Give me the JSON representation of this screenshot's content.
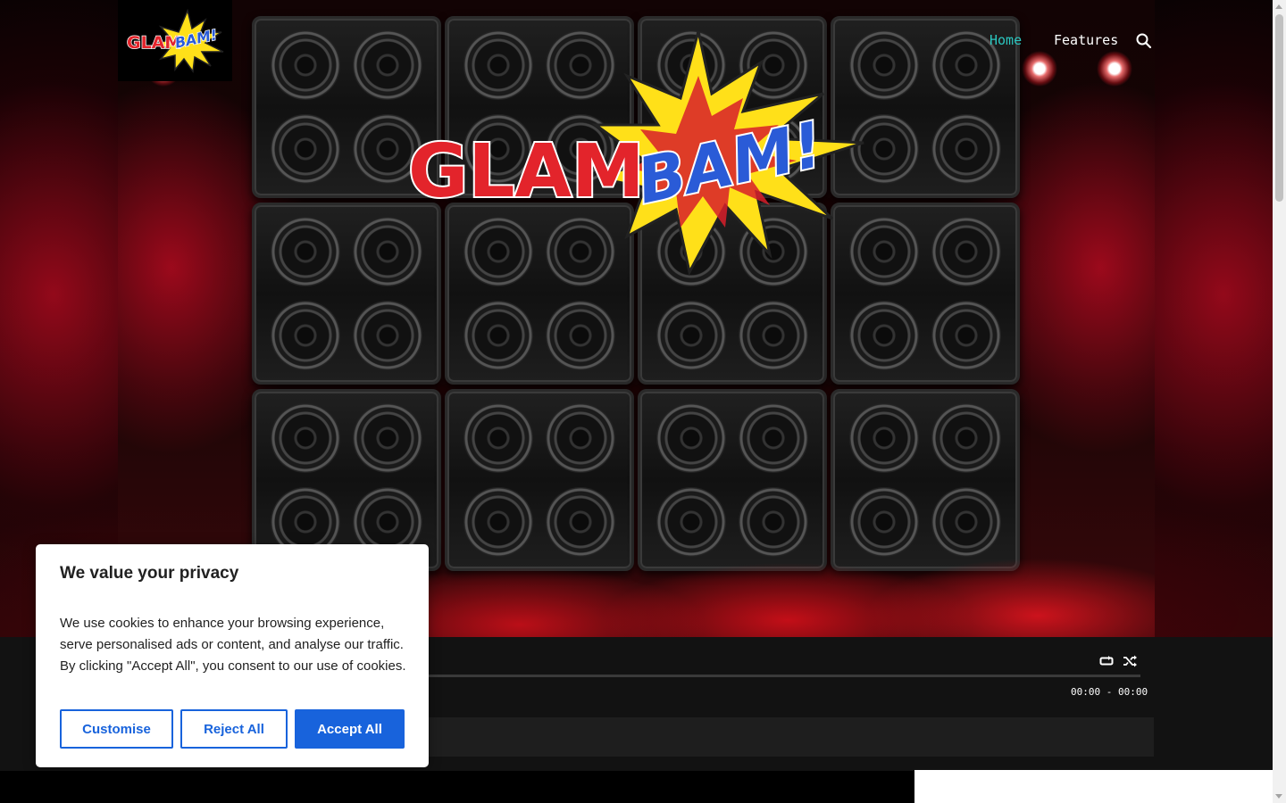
{
  "header": {
    "logo_alt": "GlamBam!",
    "nav": [
      {
        "label": "Home",
        "active": true
      },
      {
        "label": "Features",
        "active": false
      }
    ],
    "search_icon": "search-icon"
  },
  "hero": {
    "logo_text_primary": "GLAM",
    "logo_text_secondary": "BAM!",
    "speaker_cabinets": 12
  },
  "player": {
    "icons": [
      "repeat-icon",
      "shuffle-icon"
    ],
    "time": "00:00 - 00:00"
  },
  "cookie_banner": {
    "title": "We value your privacy",
    "text": "We use cookies to enhance your browsing experience, serve personalised ads or content, and analyse our traffic. By clicking \"Accept All\", you consent to our use of cookies.",
    "buttons": {
      "customise": "Customise",
      "reject": "Reject All",
      "accept": "Accept All"
    }
  },
  "colors": {
    "accent_nav": "#2bc7c0",
    "cookie_button": "#1863dc",
    "logo_red": "#e3242b",
    "logo_blue": "#2a5bd7",
    "logo_yellow": "#ffe019"
  }
}
